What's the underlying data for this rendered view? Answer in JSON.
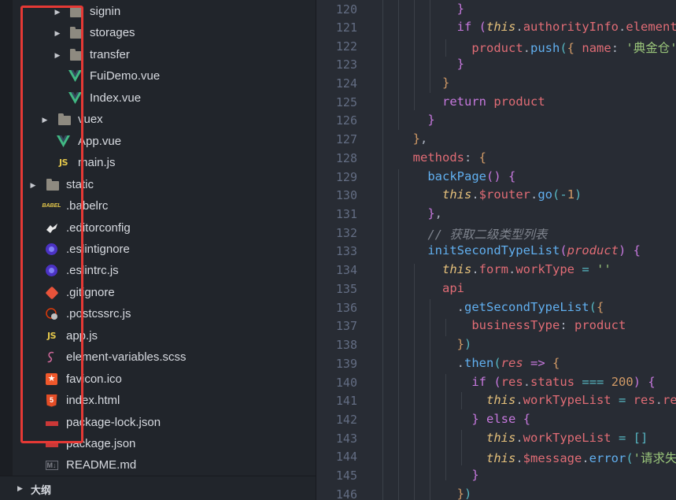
{
  "explorer": {
    "items": [
      {
        "label": "signin",
        "type": "folder",
        "icon": "folder-icon"
      },
      {
        "label": "storages",
        "type": "folder",
        "icon": "folder-icon"
      },
      {
        "label": "transfer",
        "type": "folder",
        "icon": "folder-icon"
      },
      {
        "label": "FuiDemo.vue",
        "type": "file",
        "icon": "vue-icon"
      },
      {
        "label": "Index.vue",
        "type": "file",
        "icon": "vue-icon"
      },
      {
        "label": "vuex",
        "type": "folder",
        "icon": "folder-icon"
      },
      {
        "label": "App.vue",
        "type": "file",
        "icon": "vue-icon"
      },
      {
        "label": "main.js",
        "type": "file",
        "icon": "js-icon"
      },
      {
        "label": "static",
        "type": "folder",
        "icon": "folder-icon"
      },
      {
        "label": ".babelrc",
        "type": "file",
        "icon": "babel-icon"
      },
      {
        "label": ".editorconfig",
        "type": "file",
        "icon": "editorconfig-icon"
      },
      {
        "label": ".eslintignore",
        "type": "file",
        "icon": "eslint-icon"
      },
      {
        "label": ".eslintrc.js",
        "type": "file",
        "icon": "eslint-icon"
      },
      {
        "label": ".gitignore",
        "type": "file",
        "icon": "git-icon"
      },
      {
        "label": ".postcssrc.js",
        "type": "file",
        "icon": "postcss-icon"
      },
      {
        "label": "app.js",
        "type": "file",
        "icon": "js-icon"
      },
      {
        "label": "element-variables.scss",
        "type": "file",
        "icon": "sass-icon"
      },
      {
        "label": "favicon.ico",
        "type": "file",
        "icon": "favicon-icon"
      },
      {
        "label": "index.html",
        "type": "file",
        "icon": "html-icon"
      },
      {
        "label": "package-lock.json",
        "type": "file",
        "icon": "npm-icon"
      },
      {
        "label": "package.json",
        "type": "file",
        "icon": "npm-icon"
      },
      {
        "label": "README.md",
        "type": "file",
        "icon": "markdown-icon"
      }
    ],
    "outline_label": "大纲"
  },
  "editor": {
    "line_numbers": [
      "120",
      "121",
      "122",
      "123",
      "124",
      "125",
      "126",
      "127",
      "128",
      "129",
      "130",
      "131",
      "132",
      "133",
      "134",
      "135",
      "136",
      "137",
      "138",
      "139",
      "140",
      "141",
      "142",
      "143",
      "144",
      "145",
      "146"
    ]
  },
  "theme": {
    "keyword": "#c678dd",
    "function": "#61afef",
    "property": "#e06c75",
    "string": "#98c379",
    "number": "#d19a66",
    "comment": "#7f848e",
    "highlight_box": "#e53935"
  }
}
